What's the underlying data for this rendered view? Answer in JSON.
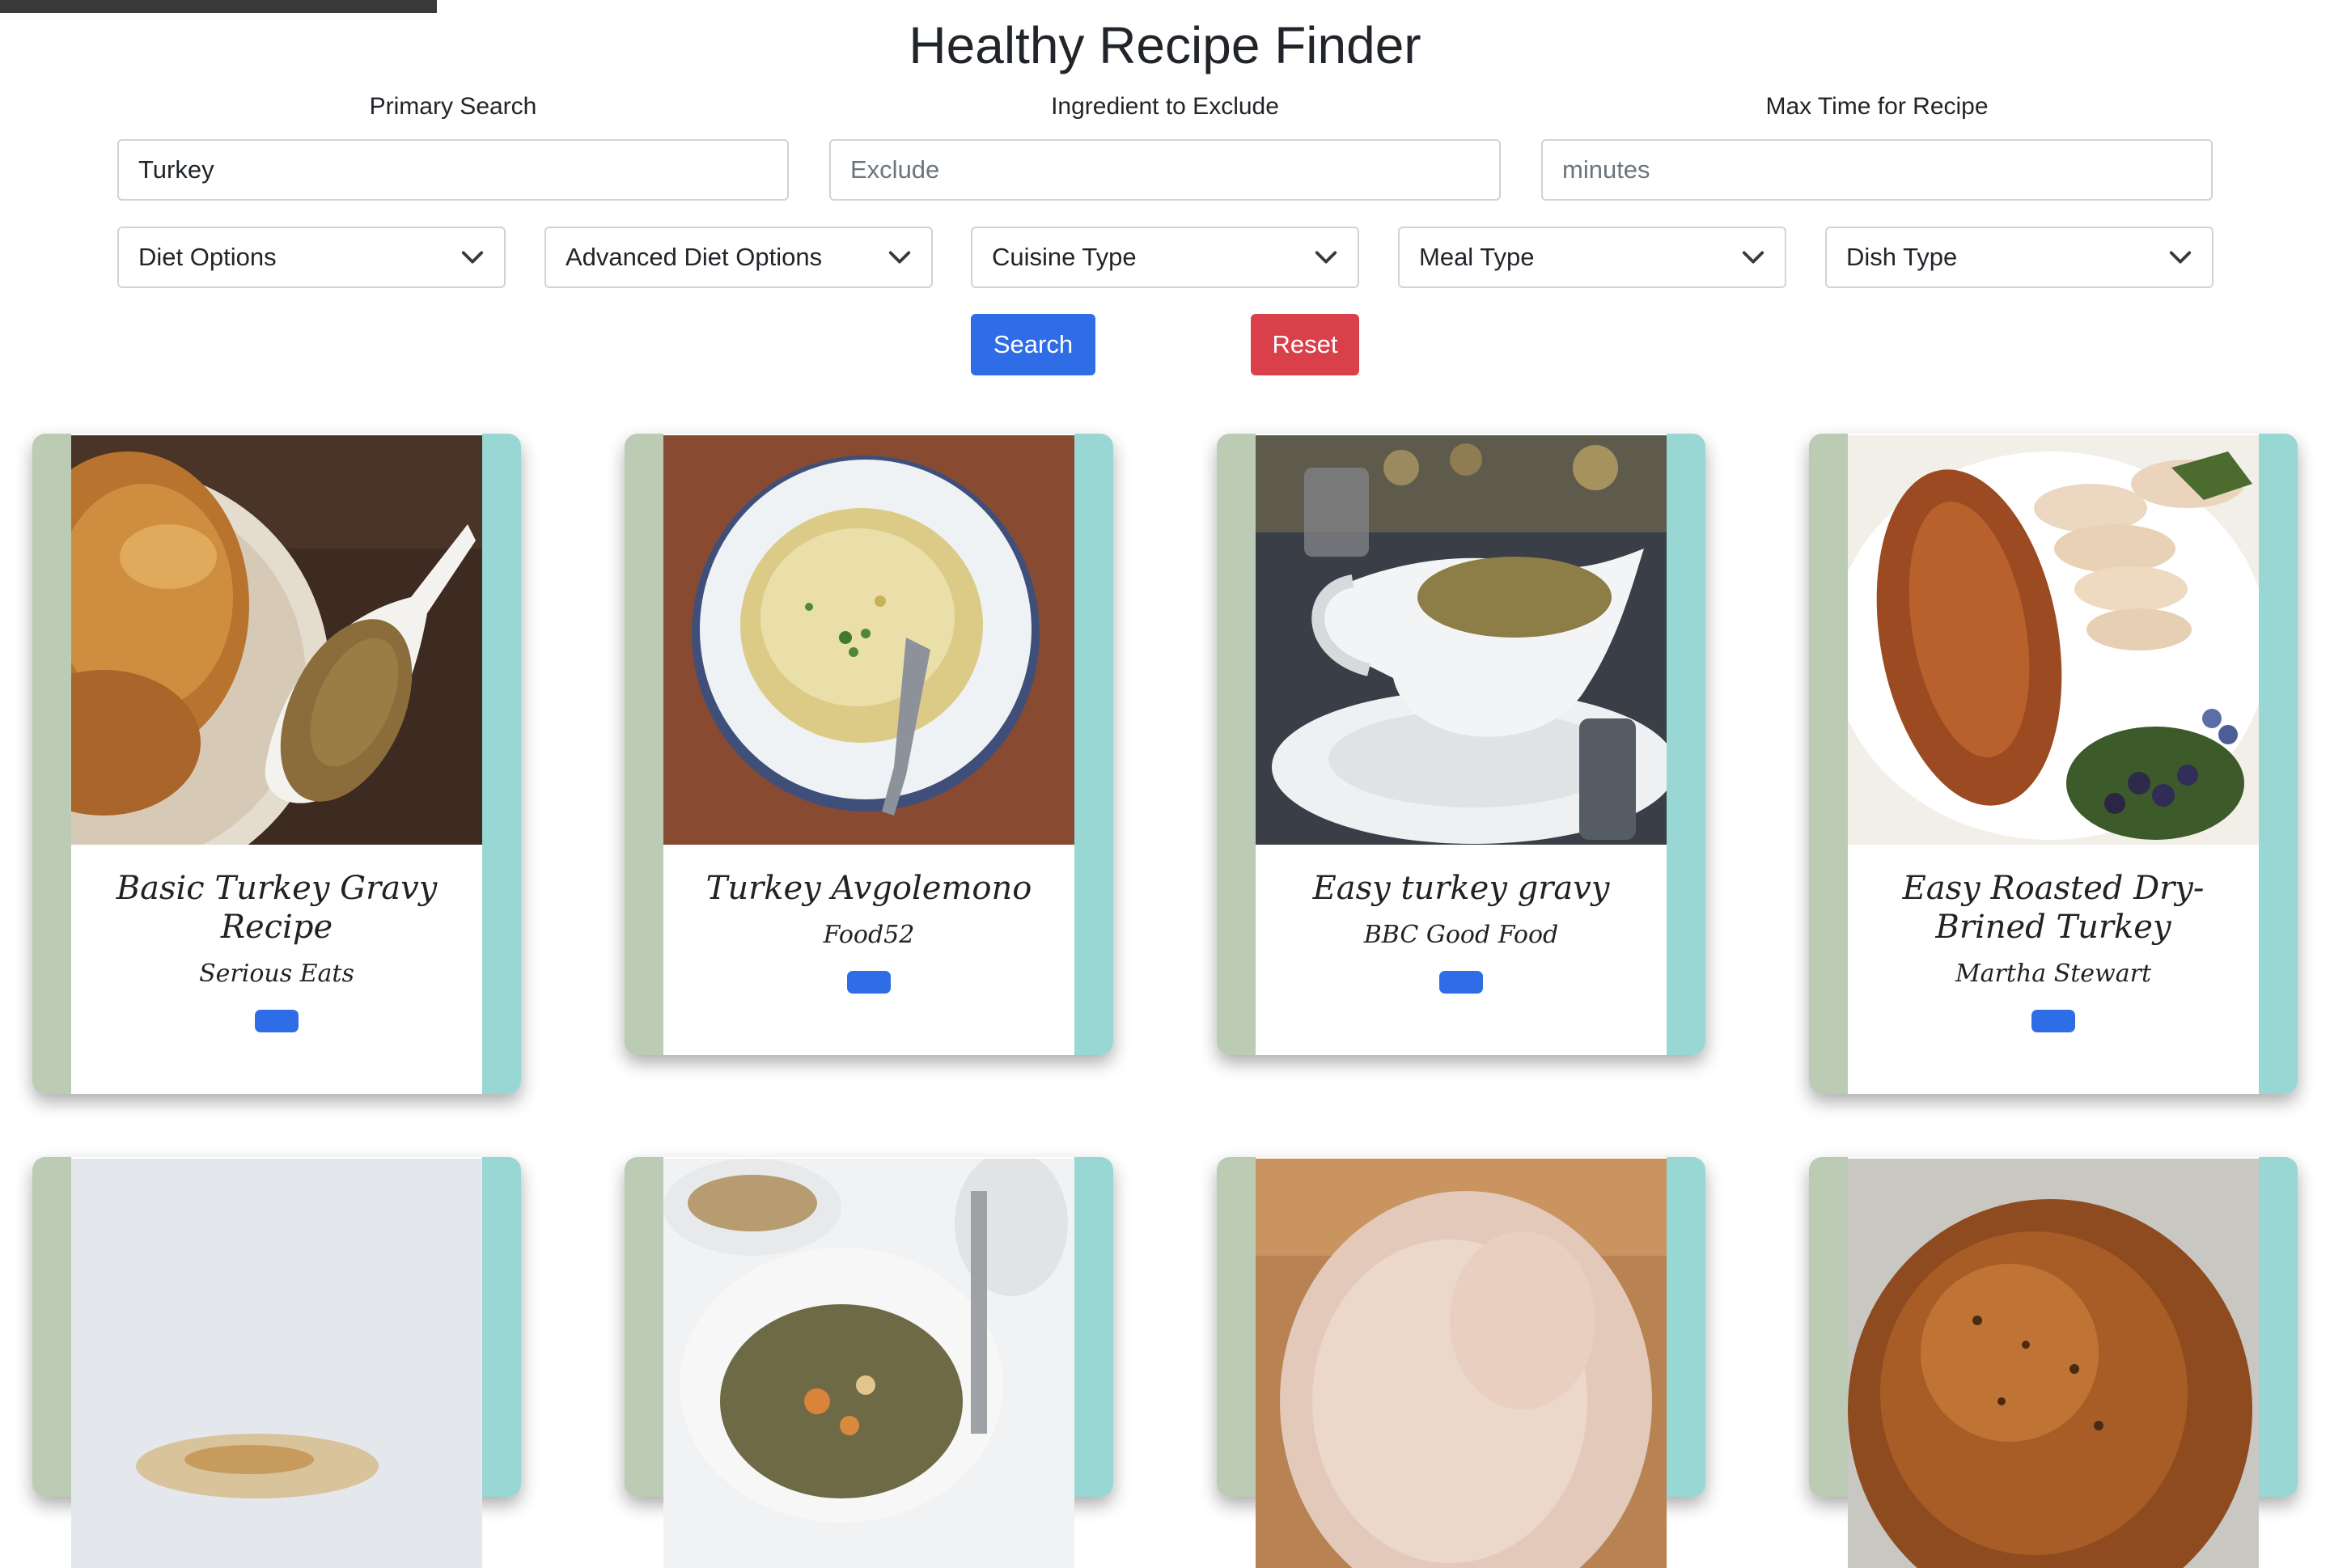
{
  "header": {
    "title": "Healthy Recipe Finder"
  },
  "search": {
    "primary_label": "Primary Search",
    "primary_value": "Turkey",
    "exclude_label": "Ingredient to Exclude",
    "exclude_placeholder": "Exclude",
    "time_label": "Max Time for Recipe",
    "time_placeholder": "minutes"
  },
  "filters": {
    "diet": "Diet Options",
    "advanced_diet": "Advanced Diet Options",
    "cuisine": "Cuisine Type",
    "meal": "Meal Type",
    "dish": "Dish Type"
  },
  "buttons": {
    "search": "Search",
    "reset": "Reset"
  },
  "recipes": [
    {
      "title": "Basic Turkey Gravy Recipe",
      "source": "Serious Eats"
    },
    {
      "title": "Turkey Avgolemono",
      "source": "Food52"
    },
    {
      "title": "Easy turkey gravy",
      "source": "BBC Good Food"
    },
    {
      "title": "Easy Roasted Dry-Brined Turkey",
      "source": "Martha Stewart"
    }
  ],
  "colors": {
    "primary": "#2f6de6",
    "danger": "#d9404a",
    "card_left": "#bccbb4",
    "card_right": "#98d7d3"
  }
}
